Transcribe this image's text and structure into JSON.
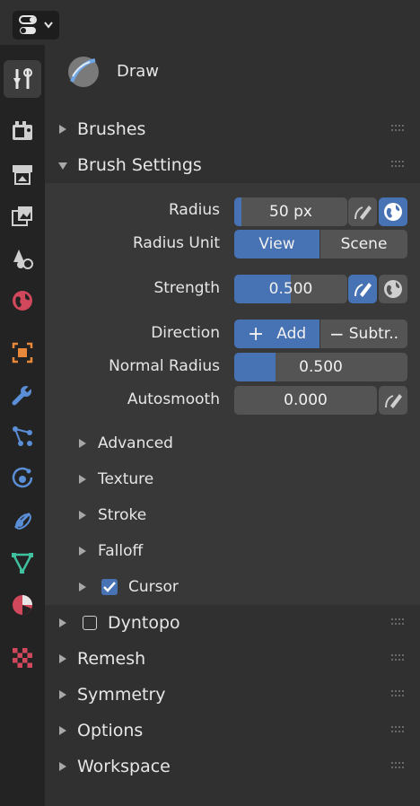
{
  "brush": {
    "name": "Draw"
  },
  "panels": {
    "brushes": "Brushes",
    "brush_settings": "Brush Settings",
    "dyntopo": "Dyntopo",
    "remesh": "Remesh",
    "symmetry": "Symmetry",
    "options": "Options",
    "workspace": "Workspace"
  },
  "settings": {
    "radius": {
      "label": "Radius",
      "value": "50 px",
      "fill_fraction": 0.03
    },
    "radius_unit": {
      "label": "Radius Unit",
      "options": [
        "View",
        "Scene"
      ],
      "selected": "View"
    },
    "strength": {
      "label": "Strength",
      "value": "0.500",
      "fill_fraction": 0.5
    },
    "direction": {
      "label": "Direction",
      "add": "Add",
      "subtract": "Subtr..",
      "selected": "Add"
    },
    "normal_radius": {
      "label": "Normal Radius",
      "value": "0.500",
      "fill_fraction": 0.24
    },
    "autosmooth": {
      "label": "Autosmooth",
      "value": "0.000",
      "fill_fraction": 0.0
    }
  },
  "subpanels": {
    "advanced": "Advanced",
    "texture": "Texture",
    "stroke": "Stroke",
    "falloff": "Falloff",
    "cursor": "Cursor"
  },
  "checkbox_states": {
    "cursor": true,
    "dyntopo": false
  },
  "property_tabs": [
    "tool",
    "render",
    "output",
    "view-layer",
    "scene",
    "world",
    "object",
    "modifiers",
    "particles",
    "physics",
    "constraints",
    "data",
    "material",
    "texture"
  ],
  "colors": {
    "accent": "#4772b3",
    "panel": "#303030",
    "field": "#545454"
  }
}
